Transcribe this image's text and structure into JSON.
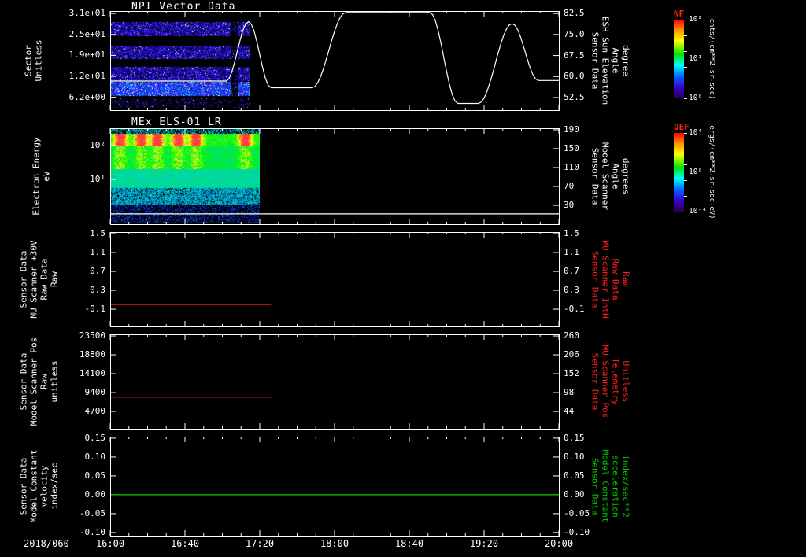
{
  "app": {
    "background": "#000000",
    "foreground": "#ffffff"
  },
  "chart_data": {
    "type": "multi-panel-timeseries-spectrogram",
    "date_label": "2018/060",
    "x_axis": {
      "start": "16:00",
      "end": "20:00",
      "tick_labels": [
        "16:00",
        "16:40",
        "17:20",
        "18:00",
        "18:40",
        "19:20",
        "20:00"
      ],
      "major_step_min": 40,
      "minor_step_min": 10,
      "duration_min": 240
    },
    "colorbars": [
      {
        "label": "NF",
        "label_color": "#ff2a00",
        "unit": "cnts/(cm**2-sr-sec)",
        "tick_labels": [
          "10²",
          "10¹",
          "10⁰"
        ],
        "gradient": [
          "#ff0000 0%",
          "#ff9900 14%",
          "#ffff00 27%",
          "#00e600 44%",
          "#00ffff 58%",
          "#0066ff 72%",
          "#3a00d0 86%",
          "#26004d 100%"
        ]
      },
      {
        "label": "DEF",
        "label_color": "#ff2a00",
        "unit": "ergs/(cm**2-sr-sec-eV)",
        "tick_labels": [
          "10⁴",
          "10⁰",
          "10⁻⁴"
        ],
        "gradient": [
          "#ff0000 0%",
          "#ff9900 14%",
          "#ffff00 27%",
          "#00e600 44%",
          "#00ffff 58%",
          "#0066ff 72%",
          "#3a00d0 86%",
          "#26004d 100%"
        ]
      }
    ],
    "panels": [
      {
        "id": "npi",
        "title": "NPI Vector Data",
        "left_axis": {
          "title_lines": [
            "Sector",
            "Unitless"
          ],
          "scale": "linear",
          "range": [
            2.4,
            31.73
          ],
          "ticks": [
            {
              "v": 31.0,
              "label": "3.1e+01"
            },
            {
              "v": 24.8,
              "label": "2.5e+01"
            },
            {
              "v": 18.6,
              "label": "1.9e+01"
            },
            {
              "v": 12.4,
              "label": "1.2e+01"
            },
            {
              "v": 6.2,
              "label": "6.2e+00"
            }
          ]
        },
        "right_axis": {
          "title_lines": [
            "Sensor Data",
            "ESH Sun Elevation",
            "Angle",
            "degree"
          ],
          "color": "#ffffff",
          "scale": "linear",
          "range": [
            48.0,
            83.4
          ],
          "ticks": [
            {
              "v": 82.5,
              "label": "82.5"
            },
            {
              "v": 75.0,
              "label": "75.0"
            },
            {
              "v": 67.5,
              "label": "67.5"
            },
            {
              "v": 60.0,
              "label": "60.0"
            },
            {
              "v": 52.5,
              "label": "52.5"
            }
          ]
        },
        "series": [
          {
            "name": "ESH Sun Elevation Angle (degree)",
            "axis": "right",
            "color": "#ffffff",
            "smooth": true,
            "points_min_value": [
              [
                0,
                58.4
              ],
              [
                62,
                58.4
              ],
              [
                74,
                79.6
              ],
              [
                86,
                56.0
              ],
              [
                108,
                56.0
              ],
              [
                126,
                82.9
              ],
              [
                171,
                82.9
              ],
              [
                186,
                50.4
              ],
              [
                197,
                50.4
              ],
              [
                215,
                78.9
              ],
              [
                229,
                58.6
              ],
              [
                240,
                58.6
              ]
            ]
          }
        ],
        "spectrogram": {
          "name": "NPI sector counts",
          "colorbar": "NF",
          "data_end_min": 75,
          "bands_f": [
            [
              0.105,
              0.25
            ],
            [
              0.345,
              0.48
            ],
            [
              0.565,
              0.71
            ],
            [
              0.72,
              0.86
            ],
            [
              0.875,
              0.985
            ]
          ],
          "band_density": [
            0.8,
            0.8,
            0.8,
            0.95,
            0.18
          ],
          "gap_x_f": [
            0.855,
            0.905
          ]
        }
      },
      {
        "id": "els",
        "title": "MEx ELS-01 LR",
        "left_axis": {
          "title_lines": [
            "Electron Energy",
            "eV"
          ],
          "scale": "log",
          "range_log10": [
            -0.32,
            2.51
          ],
          "ticks": [
            {
              "v": 100,
              "label": "10²"
            },
            {
              "v": 10,
              "label": "10¹"
            }
          ]
        },
        "right_axis": {
          "title_lines": [
            "Sensor Data",
            "Model Scanner",
            "Angle",
            "degrees"
          ],
          "color": "#ffffff",
          "scale": "linear",
          "range": [
            -9.8,
            193.2
          ],
          "ticks": [
            {
              "v": 190,
              "label": "190"
            },
            {
              "v": 150,
              "label": "150"
            },
            {
              "v": 110,
              "label": "110"
            },
            {
              "v": 70,
              "label": "70"
            },
            {
              "v": 30,
              "label": "30"
            }
          ]
        },
        "series": [
          {
            "name": "Model Scanner Angle (degrees)",
            "axis": "right",
            "color": "#ffffff",
            "smooth": false,
            "points_min_value": [
              [
                0,
                12
              ],
              [
                240,
                12
              ]
            ]
          }
        ],
        "spectrogram": {
          "name": "ELS electron energy flux",
          "colorbar": "DEF",
          "data_end_min": 80,
          "hot_x_f": [
            0.06,
            0.2,
            0.31,
            0.45,
            0.57,
            0.9
          ]
        }
      },
      {
        "id": "mu-scanner-raw",
        "left_axis": {
          "title_lines": [
            "Sensor Data",
            "MU Scanner +30V",
            "Raw Data",
            "Raw"
          ],
          "scale": "linear",
          "range": [
            -0.466,
            1.534
          ],
          "ticks": [
            {
              "v": 1.5,
              "label": "1.5"
            },
            {
              "v": 1.1,
              "label": "1.1"
            },
            {
              "v": 0.7,
              "label": "0.7"
            },
            {
              "v": 0.3,
              "label": "0.3"
            },
            {
              "v": -0.1,
              "label": "-0.1"
            }
          ]
        },
        "right_axis": {
          "title_lines": [
            "Sensor Data",
            "MU Scanner IntH",
            "Raw Data",
            "Raw"
          ],
          "color": "#ff2020",
          "scale": "linear",
          "range": [
            -0.466,
            1.534
          ],
          "ticks": [
            {
              "v": 1.5,
              "label": "1.5"
            },
            {
              "v": 1.1,
              "label": "1.1"
            },
            {
              "v": 0.7,
              "label": "0.7"
            },
            {
              "v": 0.3,
              "label": "0.3"
            },
            {
              "v": -0.1,
              "label": "-0.1"
            }
          ]
        },
        "series": [
          {
            "name": "MU Scanner IntH Raw",
            "axis": "right",
            "color": "#ff2020",
            "smooth": false,
            "points_min_value": [
              [
                0,
                0.0
              ],
              [
                86,
                0.0
              ]
            ]
          }
        ]
      },
      {
        "id": "scanner-pos",
        "left_axis": {
          "title_lines": [
            "Sensor Data",
            "Model Scanner Pos",
            "Raw",
            "unitless"
          ],
          "scale": "linear",
          "range": [
            400,
            23900
          ],
          "ticks": [
            {
              "v": 23500,
              "label": "23500"
            },
            {
              "v": 18800,
              "label": "18800"
            },
            {
              "v": 14100,
              "label": "14100"
            },
            {
              "v": 9400,
              "label": "9400"
            },
            {
              "v": 4700,
              "label": "4700"
            }
          ]
        },
        "right_axis": {
          "title_lines": [
            "Sensor Data",
            "MU Scanner Pos",
            "Telemetry",
            "Unitless"
          ],
          "color": "#ff2020",
          "scale": "linear",
          "range": [
            -5.4,
            264.6
          ],
          "ticks": [
            {
              "v": 260,
              "label": "260"
            },
            {
              "v": 206,
              "label": "206"
            },
            {
              "v": 152,
              "label": "152"
            },
            {
              "v": 98,
              "label": "98"
            },
            {
              "v": 44,
              "label": "44"
            }
          ]
        },
        "series": [
          {
            "name": "MU Scanner Pos Telemetry",
            "axis": "right",
            "color": "#ff2020",
            "smooth": false,
            "points_min_value": [
              [
                0,
                85
              ],
              [
                86,
                85
              ]
            ]
          }
        ]
      },
      {
        "id": "model-constant",
        "left_axis": {
          "title_lines": [
            "Sensor Data",
            "Model Constant",
            "velocity",
            "index/sec"
          ],
          "scale": "linear",
          "range": [
            -0.1085,
            0.154
          ],
          "ticks": [
            {
              "v": 0.15,
              "label": "0.15"
            },
            {
              "v": 0.1,
              "label": "0.10"
            },
            {
              "v": 0.05,
              "label": "0.05"
            },
            {
              "v": 0.0,
              "label": "0.00"
            },
            {
              "v": -0.05,
              "label": "-0.05"
            },
            {
              "v": -0.1,
              "label": "-0.10"
            }
          ]
        },
        "right_axis": {
          "title_lines": [
            "Sensor Data",
            "Model Constant",
            "acceleration",
            "index/sec**2"
          ],
          "color": "#00d000",
          "scale": "linear",
          "range": [
            -0.1085,
            0.154
          ],
          "ticks": [
            {
              "v": 0.15,
              "label": "0.15"
            },
            {
              "v": 0.1,
              "label": "0.10"
            },
            {
              "v": 0.05,
              "label": "0.05"
            },
            {
              "v": 0.0,
              "label": "0.00"
            },
            {
              "v": -0.05,
              "label": "-0.05"
            },
            {
              "v": -0.1,
              "label": "-0.10"
            }
          ]
        },
        "series": [
          {
            "name": "Model Constant acceleration",
            "axis": "right",
            "color": "#00d000",
            "smooth": false,
            "points_min_value": [
              [
                0,
                0.0
              ],
              [
                240,
                0.0
              ]
            ]
          }
        ]
      }
    ]
  }
}
